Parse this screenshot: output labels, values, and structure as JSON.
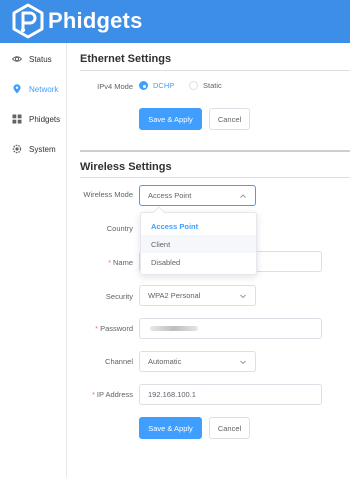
{
  "header": {
    "brand": "Phidgets",
    "logo_icon": "phidgets-logo-icon",
    "bg_color": "#3c8ee6"
  },
  "sidebar": {
    "items": [
      {
        "label": "Status",
        "icon": "eye-icon",
        "active": false
      },
      {
        "label": "Network",
        "icon": "location-pin-icon",
        "active": true
      },
      {
        "label": "Phidgets",
        "icon": "grid-icon",
        "active": false
      },
      {
        "label": "System",
        "icon": "gear-icon",
        "active": false
      }
    ]
  },
  "ethernet": {
    "title": "Ethernet Settings",
    "ipv4_label": "IPv4 Mode",
    "options": [
      "DCHP",
      "Static"
    ],
    "selected": "DCHP",
    "save_label": "Save & Apply",
    "cancel_label": "Cancel"
  },
  "wireless": {
    "title": "Wireless Settings",
    "mode_label": "Wireless Mode",
    "mode_value": "Access Point",
    "mode_options": [
      "Access Point",
      "Client",
      "Disabled"
    ],
    "country_label": "Country",
    "name_label": "Name",
    "security_label": "Security",
    "security_value": "WPA2 Personal",
    "password_label": "Password",
    "channel_label": "Channel",
    "channel_value": "Automatic",
    "ip_label": "IP Address",
    "ip_value": "192.168.100.1",
    "required_mark": "*",
    "save_label": "Save & Apply",
    "cancel_label": "Cancel"
  },
  "colors": {
    "accent": "#409eff",
    "required": "#f56c6c"
  }
}
